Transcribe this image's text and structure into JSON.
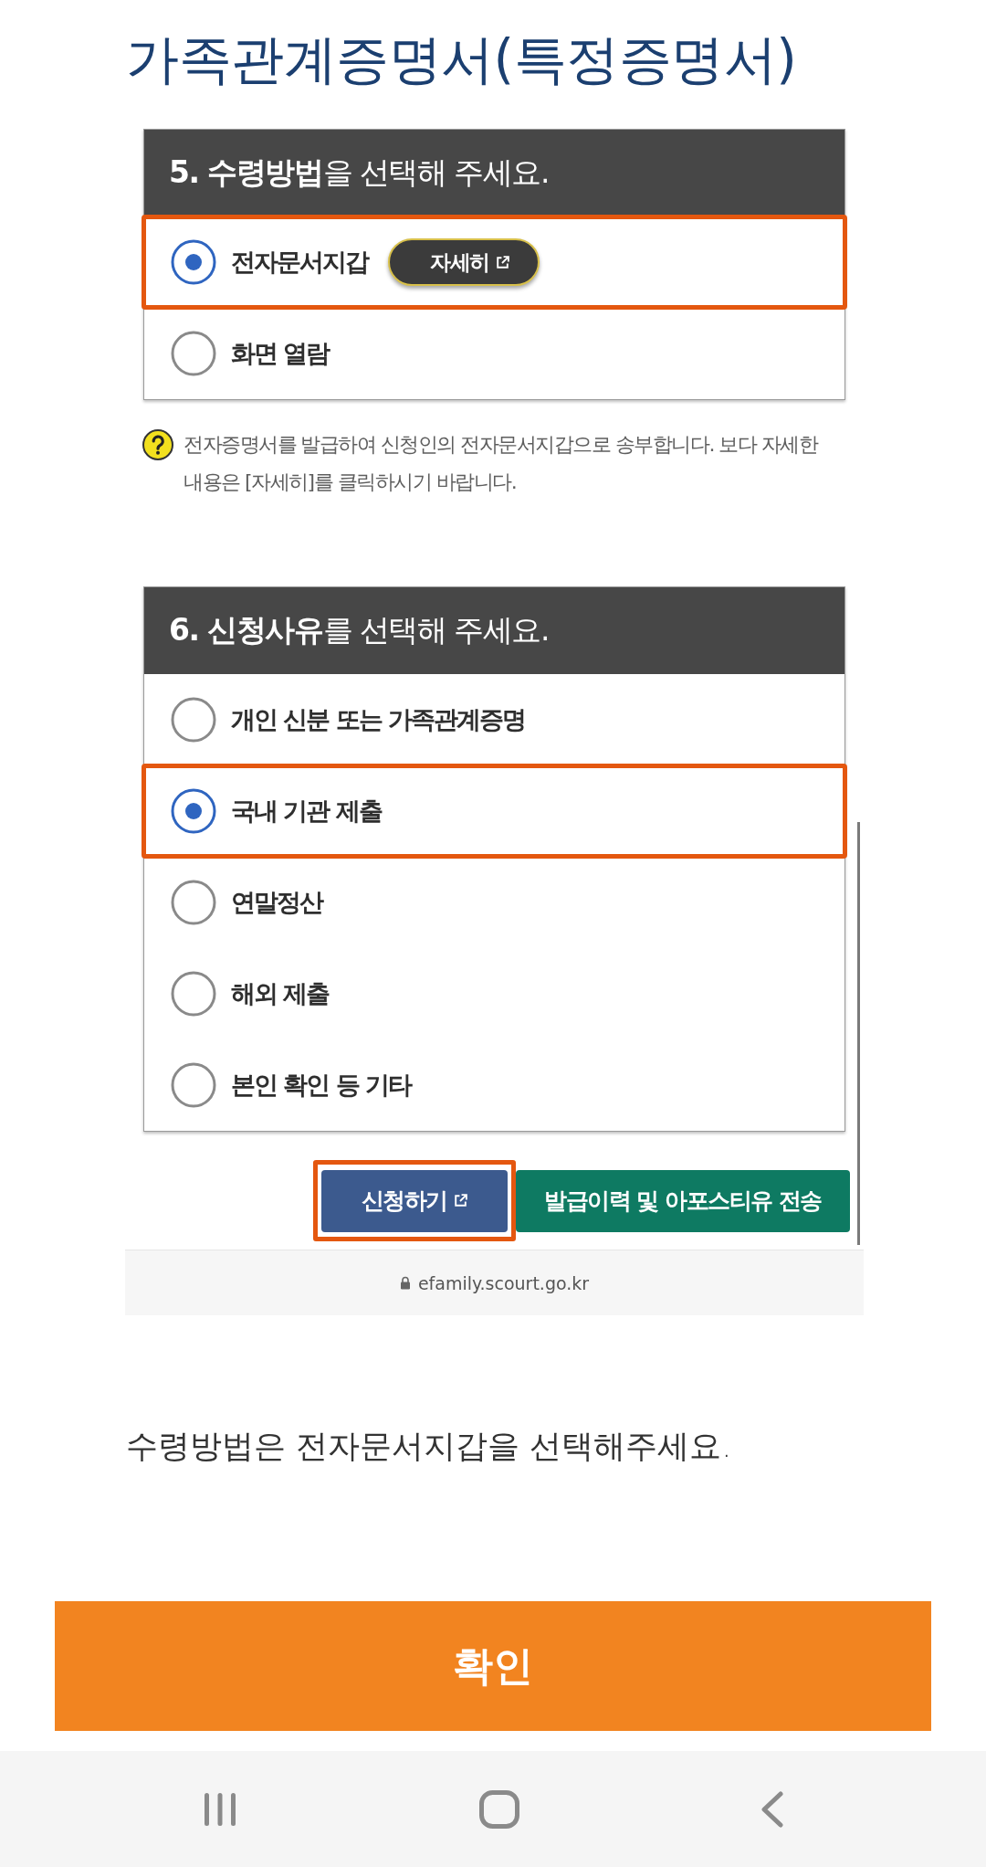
{
  "title": "가족관계증명서(특정증명서)",
  "capture": {
    "sections": [
      {
        "heading": "**5. 수령방법**을 선택해 주세요.",
        "options": [
          {
            "label": "전자문서지갑",
            "selected": true,
            "highlighted": true,
            "link": "자세히"
          },
          {
            "label": "화면 열람",
            "selected": false,
            "highlighted": false
          }
        ],
        "help": "전자증명서를 발급하여 신청인의 전자문서지갑으로 송부합니다. 보다 자세한 내용은 [자세히]를 클릭하시기 바랍니다."
      },
      {
        "heading": "**6. 신청사유**를 선택해 주세요.",
        "options": [
          {
            "label": "개인 신분 또는 가족관계증명",
            "selected": false,
            "highlighted": false
          },
          {
            "label": "국내 기관 제출",
            "selected": true,
            "highlighted": true
          },
          {
            "label": "연말정산",
            "selected": false,
            "highlighted": false
          },
          {
            "label": "해외 제출",
            "selected": false,
            "highlighted": false
          },
          {
            "label": "본인 확인 등 기타",
            "selected": false,
            "highlighted": false
          }
        ]
      }
    ],
    "buttons": [
      {
        "label": "신청하기",
        "kind": "primary",
        "external": true,
        "highlighted": true
      },
      {
        "label": "발급이력 및 아포스티유 전송",
        "kind": "secondary",
        "external": false,
        "highlighted": false
      }
    ],
    "address_bar": {
      "url": "efamily.scourt.go.kr"
    }
  },
  "instruction": "수령방법은 전자문서지갑을 선택해주세요.",
  "confirm_button": {
    "label": "확인"
  }
}
